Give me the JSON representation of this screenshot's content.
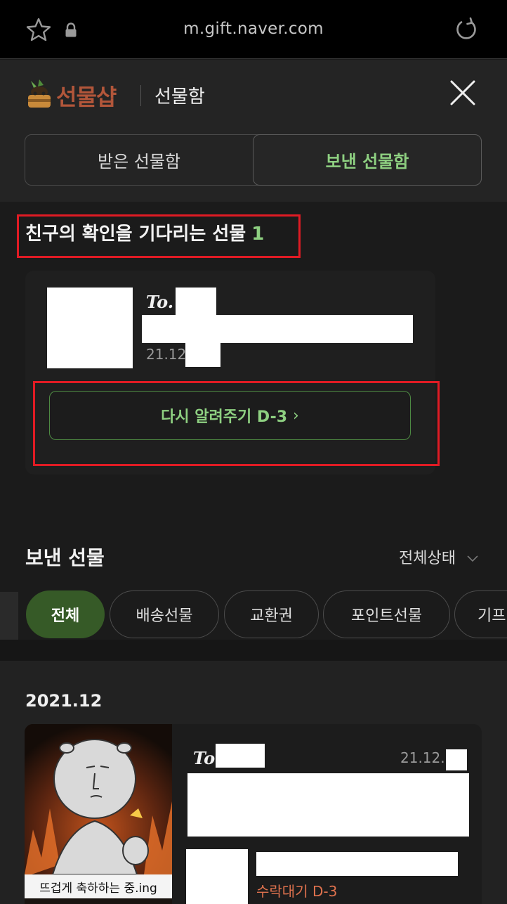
{
  "browser": {
    "url": "m.gift.naver.com",
    "icons": [
      "star-icon",
      "lock-icon",
      "reload-icon"
    ]
  },
  "header": {
    "brand": "선물샵",
    "title": "선물함",
    "tabs": [
      {
        "label": "받은 선물함",
        "active": false
      },
      {
        "label": "보낸 선물함",
        "active": true
      }
    ]
  },
  "waiting": {
    "title": "친구의 확인을 기다리는 선물",
    "count": "1",
    "card": {
      "to_label": "To.",
      "date": "21.12",
      "remind_label": "다시 알려주기 D-3",
      "remind_chevron": "›"
    }
  },
  "sent": {
    "title": "보낸 선물",
    "status_filter": "전체상태",
    "chips": [
      {
        "label": "전체",
        "active": true
      },
      {
        "label": "배송선물",
        "active": false
      },
      {
        "label": "교환권",
        "active": false
      },
      {
        "label": "포인트선물",
        "active": false
      },
      {
        "label": "기프",
        "active": false
      }
    ]
  },
  "list": {
    "month": "2021.12",
    "items": [
      {
        "to_label": "To",
        "date": "21.12.",
        "image_caption": "뜨겁게 축하하는 중.ing",
        "status": "수락대기 D-3"
      }
    ]
  },
  "colors": {
    "accent_green": "#8ed081",
    "chip_active_bg": "#365a27",
    "brand_rust": "#b2563a",
    "status_orange": "#e0724e",
    "highlight_red": "#e01b24"
  }
}
